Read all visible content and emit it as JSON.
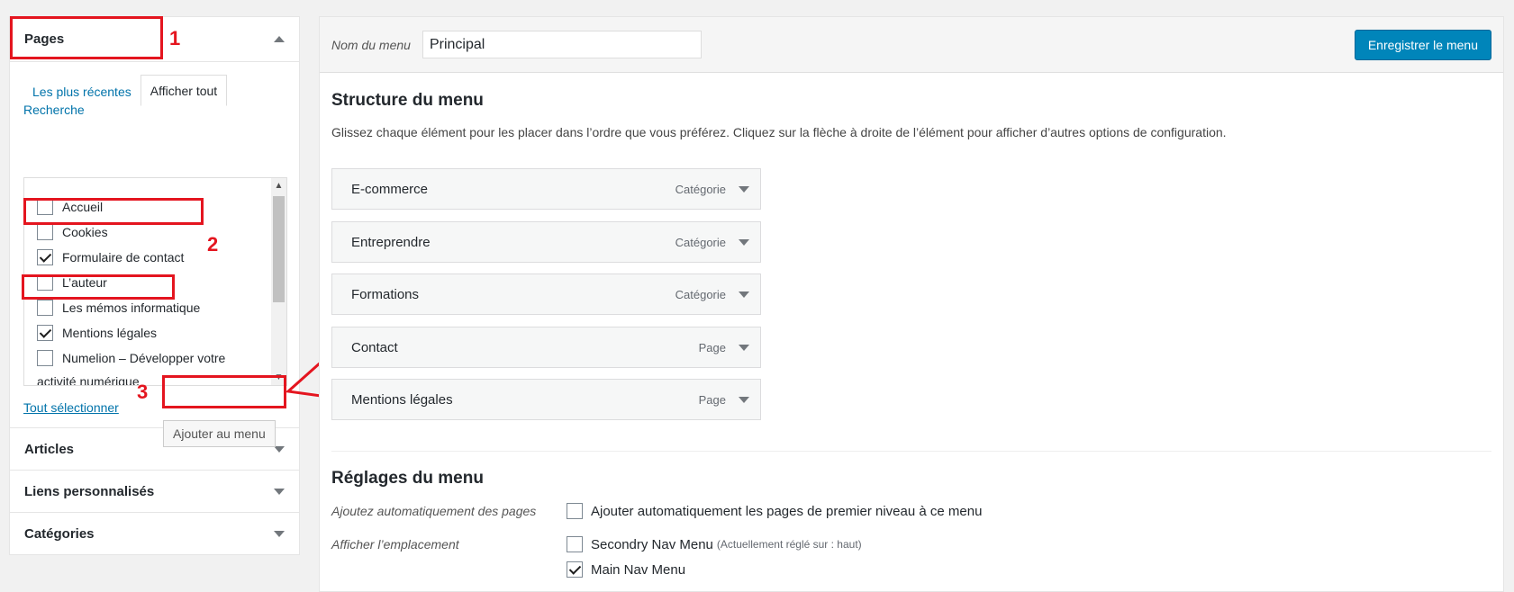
{
  "left": {
    "pages": {
      "title": "Pages",
      "tabs": {
        "recent": "Les plus récentes",
        "all": "Afficher tout",
        "search": "Recherche"
      },
      "items": [
        {
          "label": "Accueil",
          "checked": false
        },
        {
          "label": "Cookies",
          "checked": false
        },
        {
          "label": "Formulaire de contact",
          "checked": true
        },
        {
          "label": "L’auteur",
          "checked": false
        },
        {
          "label": "Les mémos informatique",
          "checked": false
        },
        {
          "label": "Mentions légales",
          "checked": true
        },
        {
          "label": "Numelion – Développer votre",
          "checked": false
        },
        {
          "label": "activité numérique",
          "checked": false
        }
      ],
      "select_all": "Tout sélectionner",
      "add_button": "Ajouter au menu"
    },
    "sections": [
      "Articles",
      "Liens personnalisés",
      "Catégories"
    ]
  },
  "annotations": [
    "1",
    "2",
    "3"
  ],
  "right": {
    "menu_name_label": "Nom du menu",
    "menu_name_value": "Principal",
    "save_button": "Enregistrer le menu",
    "structure_title": "Structure du menu",
    "structure_desc": "Glissez chaque élément pour les placer dans l’ordre que vous préférez. Cliquez sur la flèche à droite de l’élément pour afficher d’autres options de configuration.",
    "menu_items": [
      {
        "title": "E-commerce",
        "type": "Catégorie"
      },
      {
        "title": "Entreprendre",
        "type": "Catégorie"
      },
      {
        "title": "Formations",
        "type": "Catégorie"
      },
      {
        "title": "Contact",
        "type": "Page"
      },
      {
        "title": "Mentions légales",
        "type": "Page"
      }
    ],
    "settings_title": "Réglages du menu",
    "auto_add_label": "Ajoutez automatiquement des pages",
    "auto_add_option": "Ajouter automatiquement les pages de premier niveau à ce menu",
    "location_label": "Afficher l’emplacement",
    "locations": [
      {
        "label": "Secondry Nav Menu",
        "note": "(Actuellement réglé sur : haut)",
        "checked": false
      },
      {
        "label": "Main Nav Menu",
        "note": "",
        "checked": true
      }
    ]
  },
  "colors": {
    "accent": "#0085ba",
    "link": "#0073aa",
    "annotation": "#e4151f"
  }
}
